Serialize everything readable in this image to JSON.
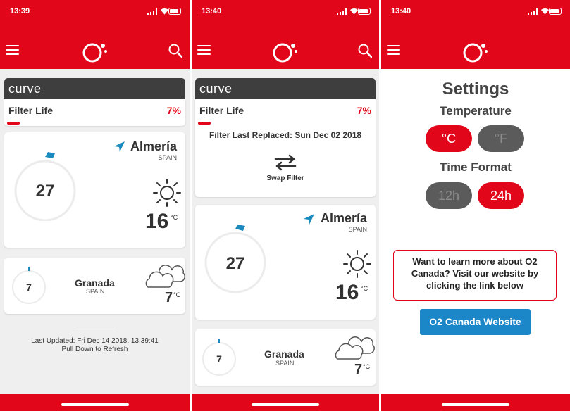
{
  "colors": {
    "accent": "#e2061b",
    "dark": "#3e3e3e",
    "link": "#1b86c8",
    "ring": "#1a8abf"
  },
  "screens": [
    {
      "time": "13:39",
      "brand": "curve",
      "filter": {
        "label": "Filter Life",
        "percent": "7%"
      },
      "main_city": {
        "name": "Almería",
        "country": "SPAIN",
        "aqi": "27",
        "temp": "16",
        "unit": "°C",
        "icon": "sun-icon"
      },
      "second_city": {
        "name": "Granada",
        "country": "SPAIN",
        "aqi": "7",
        "temp": "7",
        "unit": "°C",
        "icon": "cloud-icon"
      },
      "updated": "Last Updated: Fri Dec 14 2018, 13:39:41",
      "refresh_hint": "Pull Down to Refresh"
    },
    {
      "time": "13:40",
      "brand": "curve",
      "filter": {
        "label": "Filter Life",
        "percent": "7%"
      },
      "replaced": "Filter Last Replaced: Sun Dec 02 2018",
      "swap_label": "Swap Filter",
      "main_city": {
        "name": "Almería",
        "country": "SPAIN",
        "aqi": "27",
        "temp": "16",
        "unit": "°C",
        "icon": "sun-icon"
      },
      "second_city": {
        "name": "Granada",
        "country": "SPAIN",
        "aqi": "7",
        "temp": "7",
        "unit": "°C",
        "icon": "cloud-icon"
      }
    },
    {
      "time": "13:40",
      "title": "Settings",
      "temperature_heading": "Temperature",
      "celsius": "°C",
      "fahrenheit": "°F",
      "time_format_heading": "Time Format",
      "h12": "12h",
      "h24": "24h",
      "promo_text": "Want to learn more about O2 Canada? Visit our website by clicking the link below",
      "website_button": "O2 Canada Website"
    }
  ]
}
